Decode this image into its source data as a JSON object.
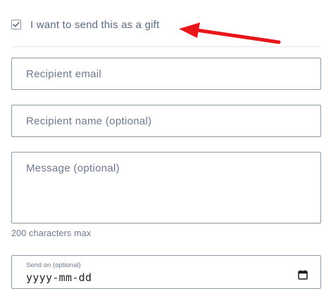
{
  "gift": {
    "checked": true,
    "label": "I want to send this as a gift"
  },
  "recipient_email": {
    "placeholder": "Recipient email",
    "value": ""
  },
  "recipient_name": {
    "placeholder": "Recipient name (optional)",
    "value": ""
  },
  "message": {
    "placeholder": "Message (optional)",
    "value": "",
    "hint": "200 characters max"
  },
  "send_on": {
    "label": "Send on (optional)",
    "value": "yyyy-mm-dd"
  },
  "colors": {
    "annotation_arrow": "#e8161b",
    "text": "#5c6b80",
    "border": "#8d9aab"
  },
  "icons": {
    "checkbox": "check-icon",
    "date_picker": "calendar-icon"
  }
}
